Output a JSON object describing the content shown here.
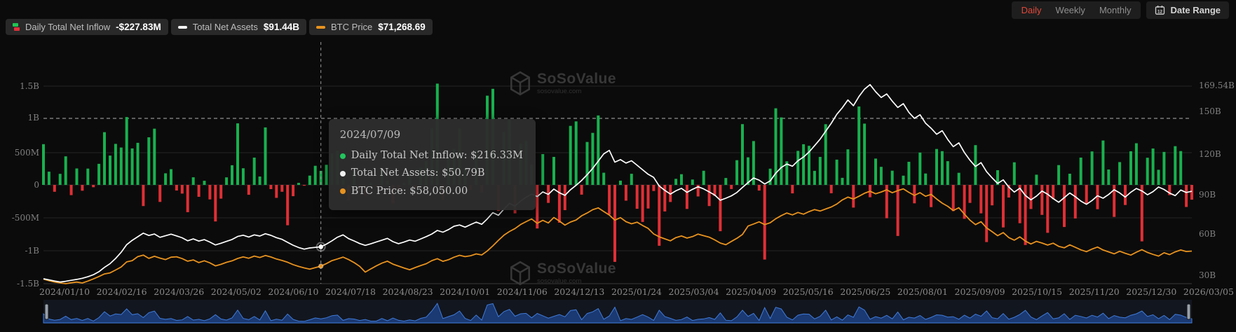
{
  "header": {
    "tabs": [
      {
        "label": "Daily",
        "active": true
      },
      {
        "label": "Weekly",
        "active": false
      },
      {
        "label": "Monthly",
        "active": false
      }
    ],
    "date_range_label": "Date Range",
    "calendar_icon_day": "12"
  },
  "legend": {
    "items": [
      {
        "label": "Daily Total Net Inflow",
        "value": "-$227.83M",
        "up_color": "#1fc553",
        "down_color": "#e0313a"
      },
      {
        "label": "Total Net Assets",
        "value": "$91.44B",
        "color": "#ffffff"
      },
      {
        "label": "BTC Price",
        "value": "$71,268.69",
        "color": "#e8921e"
      }
    ]
  },
  "watermark": {
    "brand": "SoSoValue",
    "domain": "sosovalue.com"
  },
  "tooltip": {
    "date": "2024/07/09",
    "rows": [
      {
        "label": "Daily Total Net Inflow",
        "value": "$216.33M",
        "color": "#22c55e"
      },
      {
        "label": "Total Net Assets",
        "value": "$50.79B",
        "color": "#f0f0f0"
      },
      {
        "label": "BTC Price",
        "value": "$58,050.00",
        "color": "#e8921e"
      }
    ]
  },
  "chart_data": {
    "type": "mixed",
    "title": "Bitcoin Spot ETF Daily Total Net Inflow / Total Net Assets / BTC Price",
    "x_tick_labels": [
      "2024/01/10",
      "2024/02/16",
      "2024/03/26",
      "2024/05/02",
      "2024/06/10",
      "2024/07/18",
      "2024/08/23",
      "2024/10/01",
      "2024/11/06",
      "2024/12/13",
      "2025/01/24",
      "2025/03/04",
      "2025/04/09",
      "2025/05/16",
      "2025/06/25",
      "2025/08/01",
      "2025/09/09",
      "2025/10/15",
      "2025/11/20",
      "2025/12/30",
      "2026/03/05"
    ],
    "y_axis_left": {
      "ticks": [
        "1.5B",
        "1B",
        "500M",
        "0",
        "-500M",
        "-1B",
        "-1.5B"
      ],
      "highlight_tick": "1B",
      "unit": "USD"
    },
    "y_axis_right": {
      "ticks": [
        "169.54B",
        "150B",
        "120B",
        "90B",
        "60B",
        "30B"
      ],
      "unit": "USD"
    },
    "legend_position": "top-left",
    "grid": true,
    "crosshair_index": 50,
    "series": [
      {
        "name": "Daily Total Net Inflow",
        "type": "bar",
        "unit": "$M",
        "color_positive": "#18b14e",
        "color_negative": "#e02f35",
        "values": [
          628,
          204,
          -106,
          170,
          440,
          -158,
          254,
          -90,
          251,
          -36,
          325,
          812,
          452,
          632,
          576,
          1045,
          562,
          648,
          -326,
          734,
          866,
          -262,
          179,
          243,
          -86,
          -134,
          -420,
          118,
          -183,
          64,
          -223,
          -563,
          -211,
          117,
          303,
          948,
          257,
          -152,
          421,
          129,
          886,
          -65,
          -200,
          -106,
          -621,
          -174,
          31,
          -13,
          143,
          295,
          216.33,
          310,
          485,
          528,
          92,
          -237,
          202,
          -81,
          -168,
          28,
          -30,
          252,
          65,
          -288,
          -96,
          28,
          128,
          -52,
          263,
          365,
          870,
          1560,
          -243,
          406,
          556,
          871,
          253,
          -80,
          534,
          -116,
          1374,
          1480,
          -400,
          817,
          1005,
          -438,
          640,
          676,
          308,
          -671,
          475,
          -277,
          431,
          -582,
          -388,
          909,
          978,
          -150,
          661,
          802,
          1070,
          188,
          -457,
          -1186,
          66,
          -243,
          172,
          -368,
          -571,
          -364,
          -94,
          -937,
          -409,
          -263,
          94,
          165,
          -370,
          83,
          -178,
          218,
          -326,
          -172,
          -713,
          107,
          -64,
          381,
          936,
          425,
          675,
          -87,
          -1150,
          250,
          1180,
          1040,
          363,
          -131,
          524,
          627,
          602,
          217,
          431,
          935,
          -128,
          389,
          109,
          548,
          -350,
          1208,
          944,
          -190,
          406,
          278,
          -513,
          219,
          -786,
          142,
          356,
          -284,
          498,
          176,
          -342,
          553,
          520,
          366,
          -403,
          187,
          -522,
          -277,
          613,
          -438,
          -880,
          -315,
          226,
          -655,
          -194,
          348,
          -590,
          -926,
          -371,
          158,
          -462,
          -738,
          -220,
          305,
          -648,
          173,
          -517,
          421,
          -289,
          516,
          -374,
          684,
          237,
          -493,
          352,
          -310,
          518,
          642,
          -870,
          419,
          561,
          233,
          508,
          -158,
          597,
          521,
          -340,
          -227.83
        ]
      },
      {
        "name": "Total Net Assets",
        "type": "line",
        "unit": "$B",
        "color": "#ffffff",
        "values": [
          27.5,
          26.6,
          25.8,
          25.1,
          25.6,
          26.3,
          27.0,
          27.8,
          28.9,
          30.4,
          32.6,
          35.8,
          38.5,
          42.3,
          46.8,
          52.4,
          55.6,
          58.2,
          60.8,
          59.1,
          60.2,
          57.8,
          58.9,
          60.1,
          58.8,
          57.4,
          55.2,
          56.6,
          55.0,
          56.1,
          54.3,
          52.2,
          53.4,
          54.8,
          56.2,
          58.4,
          59.3,
          58.0,
          59.6,
          58.7,
          60.4,
          59.2,
          57.5,
          56.3,
          54.1,
          52.0,
          50.3,
          49.1,
          50.0,
          50.4,
          50.79,
          52.8,
          55.2,
          57.9,
          59.6,
          56.8,
          55.1,
          53.2,
          51.9,
          53.0,
          54.4,
          55.7,
          57.0,
          54.6,
          53.1,
          54.3,
          55.8,
          54.9,
          56.6,
          58.3,
          60.2,
          62.8,
          61.5,
          63.4,
          65.9,
          66.8,
          65.2,
          67.1,
          68.9,
          67.3,
          71.2,
          75.8,
          73.9,
          78.4,
          82.6,
          80.7,
          84.3,
          87.1,
          89.4,
          87.6,
          91.0,
          89.2,
          93.1,
          90.4,
          88.5,
          92.6,
          95.8,
          99.4,
          103.6,
          108.2,
          113.5,
          118.9,
          121.4,
          112.8,
          114.6,
          112.1,
          113.8,
          110.5,
          107.2,
          103.9,
          101.6,
          95.3,
          92.1,
          89.4,
          91.8,
          93.6,
          90.7,
          92.9,
          94.8,
          93.2,
          91.0,
          88.7,
          84.9,
          86.4,
          88.1,
          90.6,
          94.3,
          97.8,
          101.2,
          99.6,
          96.8,
          99.1,
          104.7,
          108.9,
          111.4,
          109.8,
          113.8,
          116.5,
          120.2,
          124.9,
          129.6,
          135.4,
          141.2,
          147.8,
          152.6,
          158.3,
          154.1,
          160.8,
          166.2,
          169.54,
          164.3,
          160.1,
          162.7,
          157.4,
          152.8,
          155.6,
          149.2,
          144.8,
          147.5,
          141.3,
          137.6,
          133.2,
          135.8,
          129.4,
          124.1,
          126.9,
          119.8,
          114.2,
          109.6,
          112.4,
          105.8,
          101.3,
          97.2,
          99.8,
          94.6,
          90.9,
          93.7,
          88.4,
          85.2,
          87.9,
          91.6,
          89.3,
          86.1,
          83.4,
          86.8,
          90.2,
          87.5,
          84.3,
          81.9,
          84.7,
          88.2,
          86.4,
          89.1,
          92.6,
          90.3,
          87.2,
          90.8,
          93.5,
          91.7,
          88.9,
          91.2,
          94.6,
          92.8,
          90.1,
          88.3,
          92.4,
          90.6,
          91.44
        ]
      },
      {
        "name": "BTC Price",
        "type": "line",
        "unit": "$K",
        "color": "#e8921e",
        "values": [
          46.6,
          45.2,
          44.1,
          43.3,
          42.6,
          43.4,
          44.0,
          43.2,
          44.9,
          46.8,
          48.9,
          51.2,
          52.1,
          54.6,
          57.3,
          61.8,
          62.9,
          66.4,
          67.8,
          64.9,
          66.7,
          65.1,
          63.8,
          65.9,
          66.3,
          64.7,
          62.4,
          63.5,
          61.2,
          62.8,
          60.9,
          58.3,
          59.6,
          61.4,
          62.7,
          64.8,
          66.2,
          65.0,
          66.9,
          65.7,
          67.4,
          66.1,
          64.3,
          63.0,
          61.5,
          59.4,
          57.8,
          56.5,
          55.4,
          56.7,
          58.05,
          60.3,
          62.9,
          64.4,
          66.0,
          63.8,
          61.2,
          57.9,
          52.8,
          55.6,
          58.3,
          60.7,
          62.4,
          59.8,
          58.1,
          56.4,
          54.9,
          56.8,
          58.6,
          60.2,
          62.9,
          64.6,
          62.3,
          63.7,
          65.9,
          67.6,
          66.4,
          67.2,
          68.8,
          67.9,
          71.4,
          75.9,
          80.8,
          85.3,
          88.6,
          91.2,
          94.7,
          97.3,
          99.6,
          95.8,
          98.4,
          96.1,
          100.9,
          97.8,
          94.2,
          96.9,
          98.7,
          102.4,
          104.9,
          107.8,
          109.4,
          106.2,
          103.1,
          98.6,
          100.8,
          97.2,
          95.4,
          96.8,
          93.9,
          91.3,
          86.4,
          83.9,
          82.1,
          80.4,
          83.2,
          84.6,
          82.8,
          84.1,
          86.3,
          84.9,
          83.6,
          81.2,
          78.4,
          76.9,
          79.8,
          82.6,
          85.9,
          93.4,
          95.2,
          97.1,
          94.6,
          96.3,
          99.8,
          102.6,
          104.9,
          103.2,
          105.4,
          103.8,
          106.1,
          107.9,
          106.6,
          108.4,
          110.2,
          112.8,
          116.4,
          118.9,
          117.2,
          119.6,
          122.3,
          124.1,
          121.8,
          123.4,
          125.3,
          122.7,
          124.6,
          126.2,
          123.1,
          120.4,
          122.8,
          119.6,
          121.3,
          117.2,
          113.6,
          110.8,
          107.1,
          109.5,
          103.9,
          98.6,
          94.6,
          97.2,
          91.8,
          88.4,
          84.9,
          87.6,
          83.2,
          80.9,
          83.8,
          80.1,
          77.6,
          79.9,
          78.4,
          76.6,
          78.3,
          75.5,
          74.2,
          76.8,
          74.6,
          72.4,
          70.8,
          73.1,
          74.9,
          72.3,
          70.6,
          68.9,
          71.2,
          69.4,
          67.8,
          70.3,
          72.6,
          70.1,
          68.4,
          66.9,
          69.8,
          68.2,
          70.6,
          72.3,
          70.9,
          71.27
        ]
      }
    ],
    "navigator": {
      "fill": "#1c3d7a",
      "stroke": "#3f7bd9",
      "handle_color": "#98a0a8"
    }
  }
}
